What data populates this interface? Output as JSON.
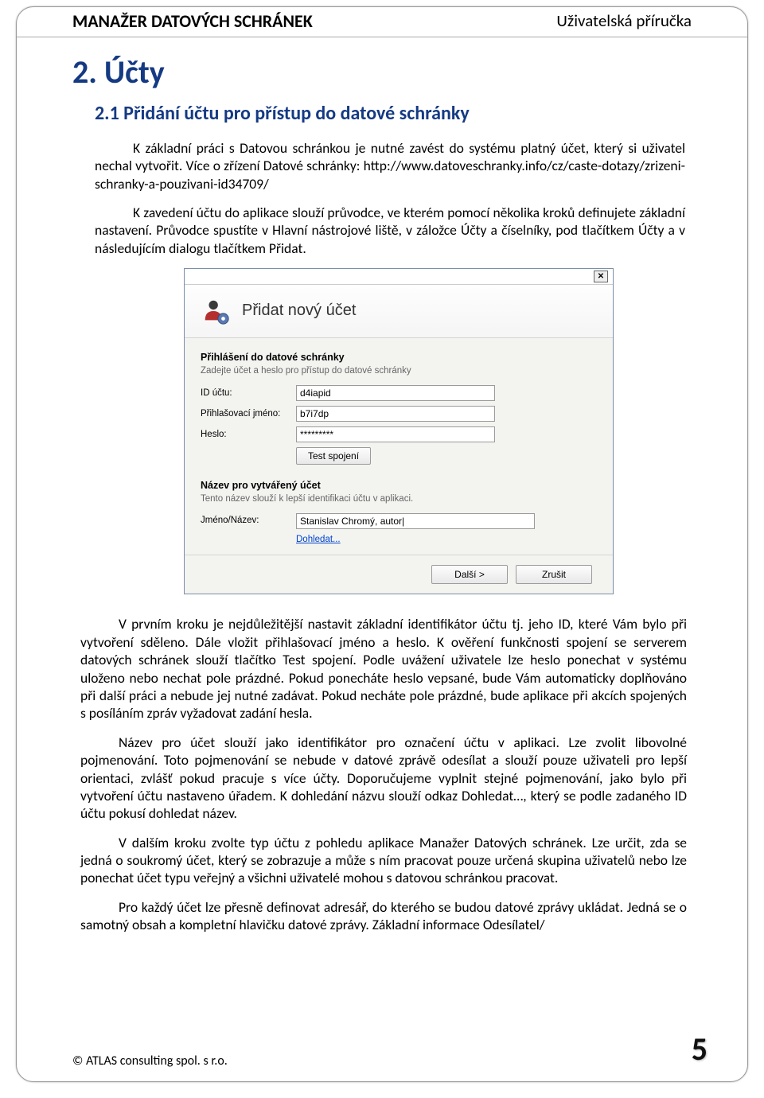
{
  "header": {
    "left": "MANAŽER DATOVÝCH SCHRÁNEK",
    "right": "Uživatelská příručka"
  },
  "h1": "2. Účty",
  "h2": "2.1 Přidání účtu pro přístup do datové schránky",
  "p1": "K základní práci s Datovou schránkou je nutné zavést do systému platný účet, který si uživatel nechal vytvořit. Více o zřízení Datové schránky: http://www.datoveschranky.info/cz/caste-dotazy/zrizeni-schranky-a-pouzivani-id34709/",
  "p2": "K zavedení účtu do aplikace slouží průvodce, ve kterém pomocí několika kroků definujete základní nastavení. Průvodce spustíte v Hlavní nástrojové liště, v záložce Účty a číselníky, pod tlačítkem Účty a v následujícím dialogu tlačítkem Přidat.",
  "dialog": {
    "title": "Přidat nový účet",
    "sect1_title": "Přihlášení do datové schránky",
    "sect1_sub": "Zadejte účet a heslo pro přístup do datové schránky",
    "id_label": "ID účtu:",
    "id_value": "d4iapid",
    "login_label": "Přihlašovací jméno:",
    "login_value": "b7i7dp",
    "pass_label": "Heslo:",
    "pass_value": "*********",
    "test_btn": "Test spojení",
    "sect2_title": "Název pro vytvářený účet",
    "sect2_sub": "Tento název slouží k lepší identifikaci účtu v aplikaci.",
    "name_label": "Jméno/Název:",
    "name_value": "Stanislav Chromý, autor|",
    "lookup": "Dohledat...",
    "next": "Další >",
    "cancel": "Zrušit"
  },
  "p3": "V prvním kroku je nejdůležitější nastavit základní identifikátor účtu tj. jeho ID, které Vám bylo při vytvoření sděleno. Dále vložit přihlašovací jméno a heslo. K ověření funkčnosti spojení se serverem datových schránek slouží tlačítko Test spojení. Podle uvážení uživatele lze heslo ponechat v systému uloženo nebo nechat pole prázdné. Pokud ponecháte heslo vepsané, bude Vám automaticky doplňováno při další práci a nebude jej nutné zadávat. Pokud necháte pole prázdné, bude aplikace při akcích spojených s posíláním zpráv vyžadovat zadání hesla.",
  "p4": "Název pro účet slouží jako identifikátor pro označení účtu v aplikaci. Lze zvolit libovolné pojmenování. Toto pojmenování se nebude v datové zprávě odesílat a slouží pouze uživateli pro lepší orientaci, zvlášť pokud pracuje s více účty. Doporučujeme vyplnit stejné pojmenování, jako bylo při vytvoření účtu nastaveno úřadem. K dohledání názvu slouží odkaz Dohledat…, který se podle zadaného ID účtu pokusí dohledat název.",
  "p5": "V dalším kroku zvolte typ účtu z pohledu aplikace Manažer Datových schránek. Lze určit, zda se jedná o soukromý účet, který se zobrazuje a může s ním pracovat pouze určená skupina uživatelů nebo lze ponechat účet typu veřejný a všichni uživatelé mohou s datovou schránkou pracovat.",
  "p6": "Pro každý účet lze přesně definovat adresář, do kterého se budou datové zprávy ukládat. Jedná se o samotný obsah a kompletní hlavičku datové zprávy. Základní informace Odesílatel/",
  "footer": {
    "copyright": "© ATLAS consulting spol. s r.o.",
    "page": "5"
  }
}
